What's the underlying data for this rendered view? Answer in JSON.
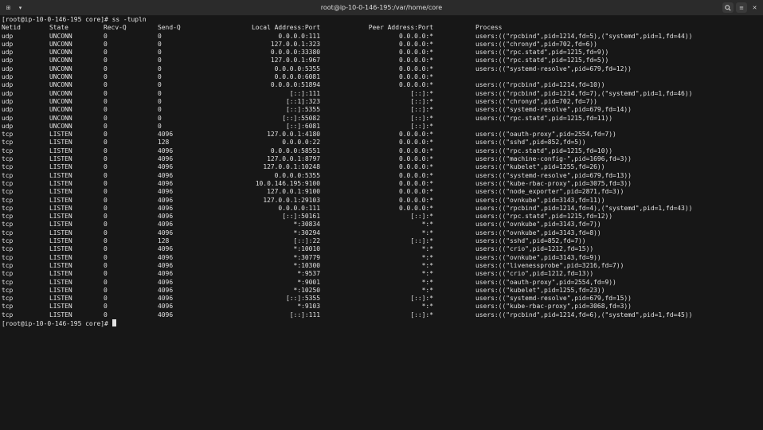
{
  "window": {
    "title": "root@ip-10-0-146-195:/var/home/core",
    "new_tab_icon": "⊞",
    "menu_icon": "▾",
    "search_icon": "🔍",
    "hamburger_icon": "≡",
    "close_icon": "✕"
  },
  "terminal": {
    "command_line": "[root@ip-10-0-146-195 core]# ss -tupln",
    "prompt_line": "[root@ip-10-0-146-195 core]# ",
    "headers": [
      "Netid",
      "State",
      "Recv-Q",
      "Send-Q",
      "Local Address:Port",
      "Peer Address:Port",
      "Process"
    ],
    "rows": [
      [
        "udp",
        "UNCONN",
        "0",
        "0",
        "0.0.0.0:111",
        "0.0.0.0:*",
        "users:((\"rpcbind\",pid=1214,fd=5),(\"systemd\",pid=1,fd=44))"
      ],
      [
        "udp",
        "UNCONN",
        "0",
        "0",
        "127.0.0.1:323",
        "0.0.0.0:*",
        "users:((\"chronyd\",pid=702,fd=6))"
      ],
      [
        "udp",
        "UNCONN",
        "0",
        "0",
        "0.0.0.0:33380",
        "0.0.0.0:*",
        "users:((\"rpc.statd\",pid=1215,fd=9))"
      ],
      [
        "udp",
        "UNCONN",
        "0",
        "0",
        "127.0.0.1:967",
        "0.0.0.0:*",
        "users:((\"rpc.statd\",pid=1215,fd=5))"
      ],
      [
        "udp",
        "UNCONN",
        "0",
        "0",
        "0.0.0.0:5355",
        "0.0.0.0:*",
        "users:((\"systemd-resolve\",pid=679,fd=12))"
      ],
      [
        "udp",
        "UNCONN",
        "0",
        "0",
        "0.0.0.0:6081",
        "0.0.0.0:*",
        ""
      ],
      [
        "udp",
        "UNCONN",
        "0",
        "0",
        "0.0.0.0:51894",
        "0.0.0.0:*",
        "users:((\"rpcbind\",pid=1214,fd=10))"
      ],
      [
        "udp",
        "UNCONN",
        "0",
        "0",
        "[::]:111",
        "[::]:*",
        "users:((\"rpcbind\",pid=1214,fd=7),(\"systemd\",pid=1,fd=46))"
      ],
      [
        "udp",
        "UNCONN",
        "0",
        "0",
        "[::1]:323",
        "[::]:*",
        "users:((\"chronyd\",pid=702,fd=7))"
      ],
      [
        "udp",
        "UNCONN",
        "0",
        "0",
        "[::]:5355",
        "[::]:*",
        "users:((\"systemd-resolve\",pid=679,fd=14))"
      ],
      [
        "udp",
        "UNCONN",
        "0",
        "0",
        "[::]:55082",
        "[::]:*",
        "users:((\"rpc.statd\",pid=1215,fd=11))"
      ],
      [
        "udp",
        "UNCONN",
        "0",
        "0",
        "[::]:6081",
        "[::]:*",
        ""
      ],
      [
        "tcp",
        "LISTEN",
        "0",
        "4096",
        "127.0.0.1:4180",
        "0.0.0.0:*",
        "users:((\"oauth-proxy\",pid=2554,fd=7))"
      ],
      [
        "tcp",
        "LISTEN",
        "0",
        "128",
        "0.0.0.0:22",
        "0.0.0.0:*",
        "users:((\"sshd\",pid=852,fd=5))"
      ],
      [
        "tcp",
        "LISTEN",
        "0",
        "4096",
        "0.0.0.0:58551",
        "0.0.0.0:*",
        "users:((\"rpc.statd\",pid=1215,fd=10))"
      ],
      [
        "tcp",
        "LISTEN",
        "0",
        "4096",
        "127.0.0.1:8797",
        "0.0.0.0:*",
        "users:((\"machine-config-\",pid=1696,fd=3))"
      ],
      [
        "tcp",
        "LISTEN",
        "0",
        "4096",
        "127.0.0.1:10248",
        "0.0.0.0:*",
        "users:((\"kubelet\",pid=1255,fd=26))"
      ],
      [
        "tcp",
        "LISTEN",
        "0",
        "4096",
        "0.0.0.0:5355",
        "0.0.0.0:*",
        "users:((\"systemd-resolve\",pid=679,fd=13))"
      ],
      [
        "tcp",
        "LISTEN",
        "0",
        "4096",
        "10.0.146.195:9100",
        "0.0.0.0:*",
        "users:((\"kube-rbac-proxy\",pid=3075,fd=3))"
      ],
      [
        "tcp",
        "LISTEN",
        "0",
        "4096",
        "127.0.0.1:9100",
        "0.0.0.0:*",
        "users:((\"node_exporter\",pid=2871,fd=3))"
      ],
      [
        "tcp",
        "LISTEN",
        "0",
        "4096",
        "127.0.0.1:29103",
        "0.0.0.0:*",
        "users:((\"ovnkube\",pid=3143,fd=11))"
      ],
      [
        "tcp",
        "LISTEN",
        "0",
        "4096",
        "0.0.0.0:111",
        "0.0.0.0:*",
        "users:((\"rpcbind\",pid=1214,fd=4),(\"systemd\",pid=1,fd=43))"
      ],
      [
        "tcp",
        "LISTEN",
        "0",
        "4096",
        "[::]:50161",
        "[::]:*",
        "users:((\"rpc.statd\",pid=1215,fd=12))"
      ],
      [
        "tcp",
        "LISTEN",
        "0",
        "4096",
        "*:30834",
        "*:*",
        "users:((\"ovnkube\",pid=3143,fd=7))"
      ],
      [
        "tcp",
        "LISTEN",
        "0",
        "4096",
        "*:30294",
        "*:*",
        "users:((\"ovnkube\",pid=3143,fd=8))"
      ],
      [
        "tcp",
        "LISTEN",
        "0",
        "128",
        "[::]:22",
        "[::]:*",
        "users:((\"sshd\",pid=852,fd=7))"
      ],
      [
        "tcp",
        "LISTEN",
        "0",
        "4096",
        "*:10010",
        "*:*",
        "users:((\"crio\",pid=1212,fd=15))"
      ],
      [
        "tcp",
        "LISTEN",
        "0",
        "4096",
        "*:30779",
        "*:*",
        "users:((\"ovnkube\",pid=3143,fd=9))"
      ],
      [
        "tcp",
        "LISTEN",
        "0",
        "4096",
        "*:10300",
        "*:*",
        "users:((\"livenessprobe\",pid=3216,fd=7))"
      ],
      [
        "tcp",
        "LISTEN",
        "0",
        "4096",
        "*:9537",
        "*:*",
        "users:((\"crio\",pid=1212,fd=13))"
      ],
      [
        "tcp",
        "LISTEN",
        "0",
        "4096",
        "*:9001",
        "*:*",
        "users:((\"oauth-proxy\",pid=2554,fd=9))"
      ],
      [
        "tcp",
        "LISTEN",
        "0",
        "4096",
        "*:10250",
        "*:*",
        "users:((\"kubelet\",pid=1255,fd=23))"
      ],
      [
        "tcp",
        "LISTEN",
        "0",
        "4096",
        "[::]:5355",
        "[::]:*",
        "users:((\"systemd-resolve\",pid=679,fd=15))"
      ],
      [
        "tcp",
        "LISTEN",
        "0",
        "4096",
        "*:9103",
        "*:*",
        "users:((\"kube-rbac-proxy\",pid=3068,fd=3))"
      ],
      [
        "tcp",
        "LISTEN",
        "0",
        "4096",
        "[::]:111",
        "[::]:*",
        "users:((\"rpcbind\",pid=1214,fd=6),(\"systemd\",pid=1,fd=45))"
      ]
    ]
  },
  "colors": {
    "background": "#171717",
    "foreground": "#e2e2e2",
    "titlebar": "#2b2b2b"
  }
}
